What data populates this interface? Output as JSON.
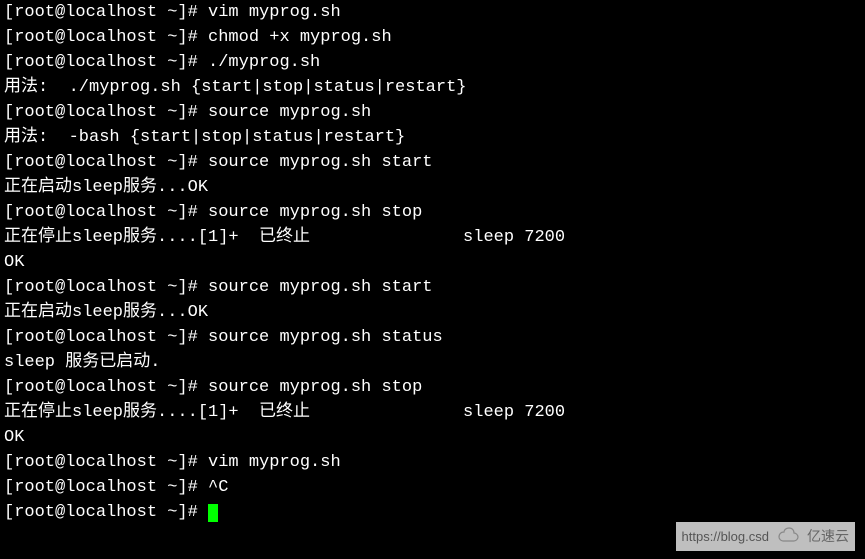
{
  "terminal": {
    "lines": [
      "[root@localhost ~]# vim myprog.sh",
      "[root@localhost ~]# chmod +x myprog.sh",
      "[root@localhost ~]# ./myprog.sh",
      "用法:  ./myprog.sh {start|stop|status|restart}",
      "[root@localhost ~]# source myprog.sh",
      "用法:  -bash {start|stop|status|restart}",
      "[root@localhost ~]# source myprog.sh start",
      "正在启动sleep服务...OK",
      "[root@localhost ~]# source myprog.sh stop",
      "正在停止sleep服务....[1]+  已终止               sleep 7200",
      "OK",
      "[root@localhost ~]# source myprog.sh start",
      "正在启动sleep服务...OK",
      "[root@localhost ~]# source myprog.sh status",
      "sleep 服务已启动.",
      "[root@localhost ~]# source myprog.sh stop",
      "正在停止sleep服务....[1]+  已终止               sleep 7200",
      "OK",
      "[root@localhost ~]# vim myprog.sh",
      "[root@localhost ~]# ^C",
      "[root@localhost ~]# "
    ]
  },
  "watermark": {
    "url": "https://blog.csd",
    "brand": "亿速云"
  }
}
